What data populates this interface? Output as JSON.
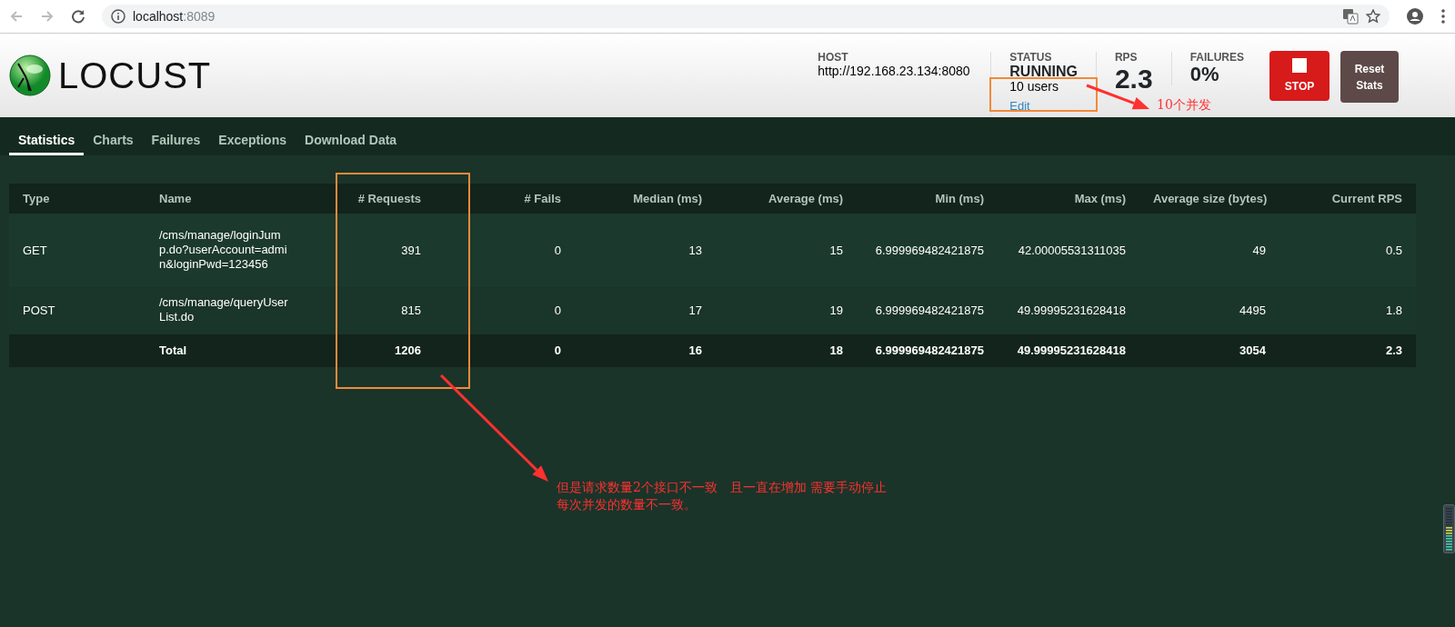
{
  "browser": {
    "address_host": "localhost",
    "address_port": ":8089"
  },
  "header": {
    "logo_text": "LOCUST",
    "stats": [
      {
        "kind": "host",
        "label": "HOST",
        "value": "http://192.168.23.134:8080"
      },
      {
        "kind": "status",
        "label": "STATUS",
        "value": "RUNNING",
        "users": "10 users",
        "edit": "Edit"
      },
      {
        "kind": "big",
        "label": "RPS",
        "value": "2.3"
      },
      {
        "kind": "big",
        "label": "FAILURES",
        "value": "0%"
      }
    ],
    "buttons": [
      {
        "kind": "stop",
        "label": "STOP"
      },
      {
        "kind": "reset",
        "label": "Reset Stats"
      }
    ]
  },
  "tabs": [
    {
      "label": "Statistics",
      "selected": true
    },
    {
      "label": "Charts",
      "selected": false
    },
    {
      "label": "Failures",
      "selected": false
    },
    {
      "label": "Exceptions",
      "selected": false
    },
    {
      "label": "Download Data",
      "selected": false
    }
  ],
  "table": {
    "columns": [
      "Type",
      "Name",
      "# Requests",
      "# Fails",
      "Median (ms)",
      "Average (ms)",
      "Min (ms)",
      "Max (ms)",
      "Average size (bytes)",
      "Current RPS"
    ],
    "rows": [
      {
        "kind": "entry",
        "cells": [
          "GET",
          "/cms/manage/loginJump.do?userAccount=admin&loginPwd=123456",
          "391",
          "0",
          "13",
          "15",
          "6.999969482421875",
          "42.00005531311035",
          "49",
          "0.5"
        ]
      },
      {
        "kind": "entry",
        "cells": [
          "POST",
          "/cms/manage/queryUserList.do",
          "815",
          "0",
          "17",
          "19",
          "6.999969482421875",
          "49.99995231628418",
          "4495",
          "1.8"
        ]
      },
      {
        "kind": "total",
        "cells": [
          "",
          "Total",
          "1206",
          "0",
          "16",
          "18",
          "6.999969482421875",
          "49.99995231628418",
          "3054",
          "2.3"
        ]
      }
    ]
  },
  "annotations": [
    {
      "kind": "users",
      "lines": [
        "10个并发"
      ]
    },
    {
      "kind": "requests",
      "lines": [
        "但是请求数量2个接口不一致　且一直在增加 需要手动停止",
        "每次并发的数量不一致。"
      ]
    }
  ]
}
